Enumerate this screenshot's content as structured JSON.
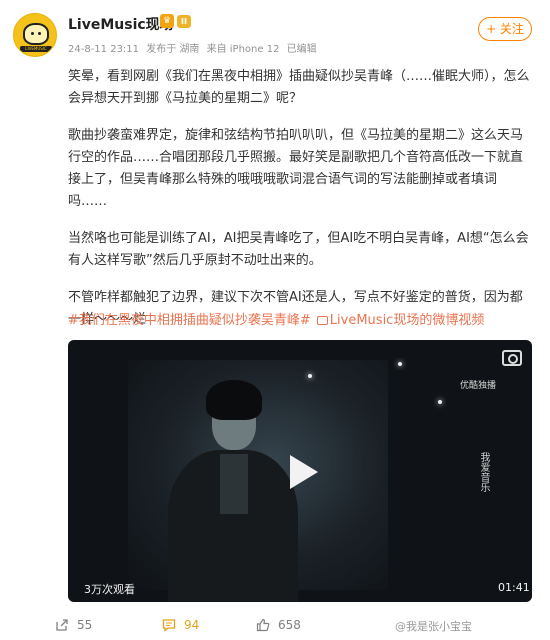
{
  "author": {
    "name": "LiveMusic现场",
    "crown_glyph": "♛",
    "level": "II",
    "avatar_text": "LIVEMUSIC"
  },
  "meta": {
    "date": "24-8-11 23:11",
    "source": "发布于 湖南",
    "device": "来自 iPhone 12",
    "edited": "已编辑"
  },
  "follow_label": "+ 关注",
  "post": {
    "paragraphs": [
      "笑晕，看到网剧《我们在黑夜中相拥》插曲疑似抄吴青峰（……催眠大师），怎么会异想天开到挪《马拉美的星期二》呢？",
      "歌曲抄袭蛮难界定，旋律和弦结构节拍叭叭叭，但《马拉美的星期二》这么天马行空的作品……合唱团那段几乎照搬。最好笑是副歌把几个音符高低改一下就直接上了，但吴青峰那么特殊的哦哦哦歌词混合语气词的写法能删掉或者填词吗……",
      "当然咯也可能是训练了AI，AI把吴青峰吃了，但AI吃不明白吴青峰，AI想“怎么会有人这样写歌”然后几乎原封不动吐出来的。",
      "不管咋样都触犯了边界，建议下次不管AI还是人，写点不好鉴定的普货，因为都一样～～～烂"
    ]
  },
  "topics": {
    "hashtag": "#我们在黑夜中相拥插曲疑似抄袭吴青峰#",
    "video_link": "LiveMusic现场的微博视频"
  },
  "video": {
    "views": "3万次观看",
    "duration": "01:41",
    "overlay_brand": "优酷独播",
    "overlay_text": "我爱音乐"
  },
  "actions": {
    "forward_count": "55",
    "comment_count": "94",
    "like_count": "658",
    "comment_color": "#e4a21a"
  },
  "watermark": "@我是张小宝宝"
}
